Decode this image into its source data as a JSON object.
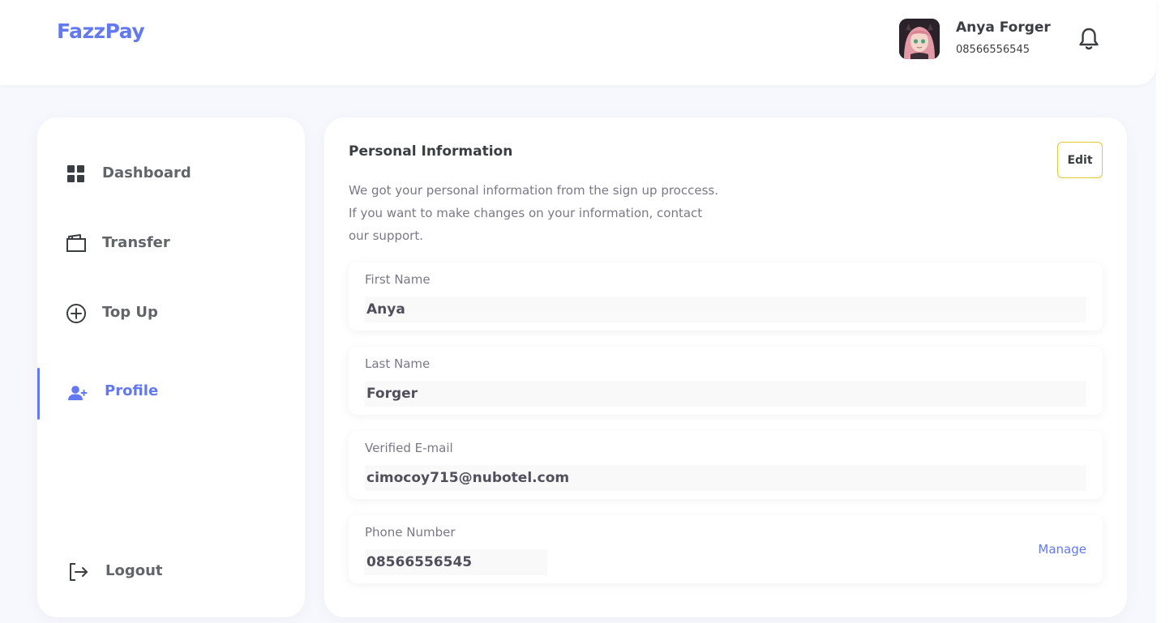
{
  "app": {
    "brand": "FazzPay"
  },
  "header": {
    "user_name": "Anya Forger",
    "user_phone": "08566556545",
    "bell_icon": "bell-icon"
  },
  "sidebar": {
    "items": [
      {
        "label": "Dashboard",
        "icon": "grid-icon",
        "active": false
      },
      {
        "label": "Transfer",
        "icon": "wallet-icon",
        "active": false
      },
      {
        "label": "Top Up",
        "icon": "plus-circle-icon",
        "active": false
      },
      {
        "label": "Profile",
        "icon": "user-plus-icon",
        "active": true
      }
    ],
    "logout": {
      "label": "Logout",
      "icon": "logout-icon"
    }
  },
  "main": {
    "title": "Personal Information",
    "description": "We got your personal information from the sign up proccess. If you want to make changes on your information, contact our support.",
    "edit_label": "Edit",
    "fields": [
      {
        "label": "First Name",
        "value": "Anya"
      },
      {
        "label": "Last Name",
        "value": "Forger"
      },
      {
        "label": "Verified E-mail",
        "value": "cimocoy715@nubotel.com"
      },
      {
        "label": "Phone Number",
        "value": "08566556545"
      }
    ],
    "manage_label": "Manage"
  },
  "colors": {
    "accent": "#6379f4",
    "edit_border": "#e6c832",
    "text_primary": "#3a3d42",
    "text_muted": "#7a7886",
    "page_background": "#f7f8fd"
  }
}
